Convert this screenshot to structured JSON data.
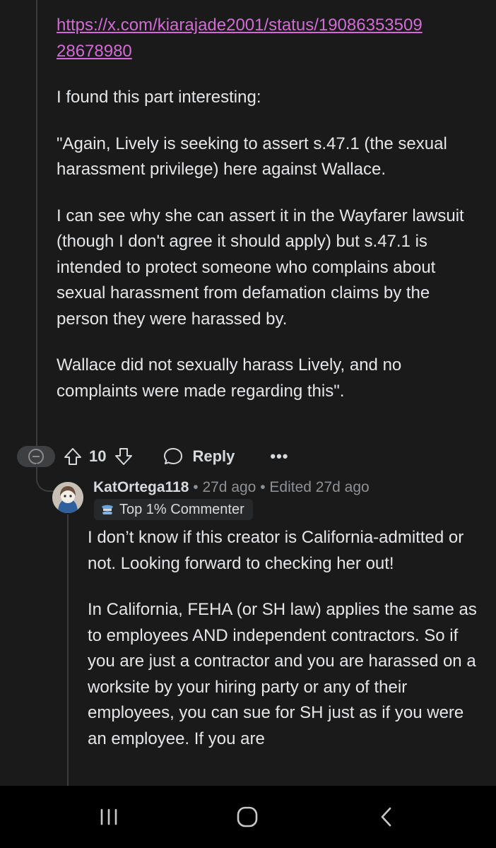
{
  "post": {
    "link": "https://x.com/kiarajade2001/status/1908635350928678980",
    "link_line1": "https://x.com/kiarajade2001/status/19086353509",
    "link_line2": "28678980",
    "paragraphs": [
      "I found this part interesting:",
      "\"Again, Lively is seeking to assert s.47.1 (the sexual harassment privilege) here against Wallace.",
      "I can see why she can assert it in the Wayfarer lawsuit (though I don't agree it should apply) but s.47.1 is intended to protect someone who complains about sexual harassment from defamation claims by the person they were harassed by.",
      "Wallace did not sexually harass Lively, and no complaints were made regarding this\"."
    ]
  },
  "actions": {
    "vote_count": "10",
    "reply_label": "Reply",
    "more_label": "•••"
  },
  "reply": {
    "username": "KatOrtega118",
    "separator": "•",
    "time": "27d ago",
    "edited": "Edited 27d ago",
    "flair": "Top 1% Commenter",
    "paragraphs": [
      "I don’t know if this creator is California-admitted or not. Looking forward to checking her out!",
      "In California, FEHA (or SH law) applies the same as to employees AND independent contractors. So if you are just a contractor and you are harassed on a worksite by your hiring party or any of their employees, you can sue for SH just as if you were an employee. If you are"
    ]
  },
  "icons": {
    "collapse": "collapse-minus-icon",
    "upvote": "upvote-arrow-icon",
    "downvote": "downvote-arrow-icon",
    "reply": "speech-bubble-icon",
    "flair": "commenter-badge-icon",
    "nav_recents": "recents-icon",
    "nav_home": "home-icon",
    "nav_back": "back-icon"
  },
  "colors": {
    "background": "#1a1a1b",
    "link": "#d36bd6",
    "text": "#e4e6e8",
    "muted": "#8e9194"
  }
}
